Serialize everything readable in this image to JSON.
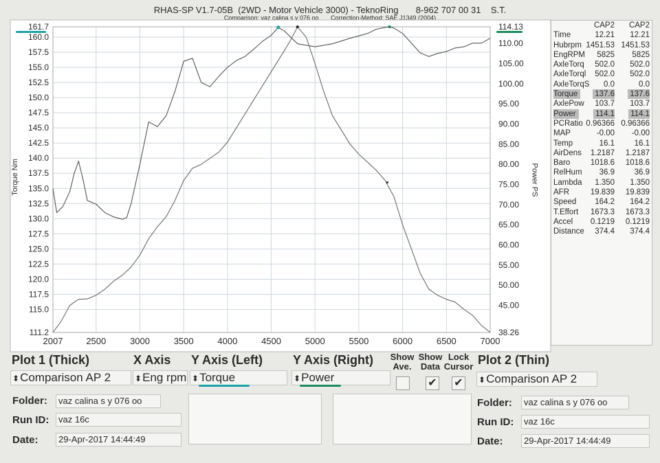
{
  "header": {
    "title": "RHAS-SP V1.7-05B  (2WD - Motor Vehicle 3000) - TeknoRing       8-962 707 00 31    S.T.",
    "subtitle": "Comparison: vaz calina s y 076 oo       Correction-Method: SAE J1349 (2004)"
  },
  "chart_data": {
    "type": "line",
    "xlabel": "",
    "ylabel_left": "Torque Nm",
    "ylabel_right": "Power PS",
    "xlim": [
      2007,
      7000
    ],
    "ylim_left": [
      111.2,
      161.7
    ],
    "ylim_right": [
      38.26,
      114.13
    ],
    "x_ticks": [
      "2007",
      "2500",
      "3000",
      "3500",
      "4000",
      "4500",
      "5000",
      "5500",
      "6000",
      "6500",
      "7000"
    ],
    "left_ticks": [
      "161.7",
      "160.0",
      "157.5",
      "155.0",
      "152.5",
      "150.0",
      "147.5",
      "145.0",
      "142.5",
      "140.0",
      "137.5",
      "135.0",
      "132.5",
      "130.0",
      "127.5",
      "125.0",
      "122.5",
      "120.0",
      "117.5",
      "115.0",
      "111.2"
    ],
    "right_ticks": [
      "114.13",
      "110.00",
      "105.00",
      "100.00",
      "95.00",
      "90.00",
      "85.00",
      "80.00",
      "75.00",
      "70.00",
      "65.00",
      "60.00",
      "55.00",
      "50.00",
      "45.00",
      "38.26"
    ],
    "grid": true,
    "series": [
      {
        "name": "Torque",
        "axis": "left",
        "x": [
          2007,
          2050,
          2120,
          2200,
          2250,
          2300,
          2350,
          2400,
          2500,
          2600,
          2700,
          2800,
          2850,
          2900,
          3000,
          3100,
          3200,
          3300,
          3400,
          3500,
          3600,
          3700,
          3800,
          3900,
          4000,
          4100,
          4200,
          4300,
          4400,
          4500,
          4580,
          4650,
          4800,
          5000,
          5200,
          5400,
          5600,
          5700,
          5800,
          5850,
          5900,
          6000,
          6100,
          6200,
          6300,
          6400,
          6500,
          6600,
          6700,
          6800,
          6900,
          7000
        ],
        "y": [
          135.0,
          131.0,
          132.0,
          134.5,
          137.5,
          139.5,
          136.5,
          133.0,
          132.4,
          131.0,
          130.3,
          129.9,
          130.2,
          132.5,
          139.0,
          146.0,
          145.2,
          147.0,
          151.0,
          156.0,
          156.5,
          152.5,
          151.8,
          153.5,
          155.0,
          156.1,
          156.8,
          158.0,
          159.3,
          160.3,
          161.6,
          161.0,
          158.9,
          158.4,
          158.9,
          159.8,
          160.6,
          161.3,
          161.6,
          161.7,
          161.5,
          160.6,
          159.0,
          157.4,
          156.8,
          157.3,
          157.6,
          158.2,
          158.4,
          159.0,
          159.0,
          159.8
        ]
      },
      {
        "name": "Power",
        "axis": "right",
        "x": [
          2007,
          2100,
          2200,
          2300,
          2400,
          2500,
          2600,
          2700,
          2800,
          2900,
          3000,
          3100,
          3200,
          3300,
          3400,
          3500,
          3600,
          3700,
          3800,
          3900,
          4000,
          4100,
          4200,
          4300,
          4400,
          4500,
          4600,
          4700,
          4800,
          4900,
          5000,
          5100,
          5200,
          5300,
          5400,
          5500,
          5600,
          5700,
          5800,
          5900,
          6000,
          6100,
          6200,
          6300,
          6400,
          6500,
          6600,
          6700,
          6800,
          6900,
          7000
        ],
        "y": [
          38.3,
          41.0,
          45.0,
          46.5,
          46.6,
          47.5,
          49.0,
          51.0,
          52.5,
          54.5,
          57.5,
          61.5,
          64.5,
          67.0,
          71.0,
          76.0,
          79.0,
          80.0,
          81.5,
          83.0,
          85.5,
          89.0,
          92.5,
          96.0,
          99.5,
          103.0,
          106.5,
          110.0,
          114.1,
          111.5,
          105.0,
          98.0,
          92.0,
          88.5,
          85.0,
          82.5,
          80.5,
          78.5,
          76.0,
          72.0,
          65.0,
          59.0,
          53.0,
          49.0,
          47.5,
          46.5,
          45.8,
          44.0,
          42.5,
          40.0,
          38.3
        ]
      }
    ],
    "annotations": [
      {
        "series": "Torque",
        "x": 5850,
        "y": 161.7
      },
      {
        "series": "Power",
        "x": 4800,
        "y": 114.1
      }
    ],
    "colors": {
      "torque": "#555555",
      "power": "#6a6a6a",
      "grid": "#cfd7df",
      "teal_marker": "#1aa2a8",
      "green_marker": "#1a8a5c"
    }
  },
  "readout": {
    "columns": [
      "CAP2",
      "CAP2"
    ],
    "rows": [
      {
        "name": "Time",
        "v1": "12.21",
        "v2": "12.21",
        "hl": false
      },
      {
        "name": "Hubrpm",
        "v1": "1451.53",
        "v2": "1451.53",
        "hl": false
      },
      {
        "name": "EngRPM",
        "v1": "5825",
        "v2": "5825",
        "hl": false
      },
      {
        "name": "AxleTorq",
        "v1": "502.0",
        "v2": "502.0",
        "hl": false
      },
      {
        "name": "AxleTorql",
        "v1": "502.0",
        "v2": "502.0",
        "hl": false
      },
      {
        "name": "AxleTorqS",
        "v1": "0.0",
        "v2": "0.0",
        "hl": false
      },
      {
        "name": "Torque",
        "v1": "137.6",
        "v2": "137.6",
        "hl": true
      },
      {
        "name": "AxlePow",
        "v1": "103.7",
        "v2": "103.7",
        "hl": false
      },
      {
        "name": "Power",
        "v1": "114.1",
        "v2": "114.1",
        "hl": true
      },
      {
        "name": "PCRatio",
        "v1": "0.96366",
        "v2": "0.96366",
        "hl": false
      },
      {
        "name": "MAP",
        "v1": "-0.00",
        "v2": "-0.00",
        "hl": false
      },
      {
        "name": "Temp",
        "v1": "16.1",
        "v2": "16.1",
        "hl": false
      },
      {
        "name": "AirDens",
        "v1": "1.2187",
        "v2": "1.2187",
        "hl": false
      },
      {
        "name": "Baro",
        "v1": "1018.6",
        "v2": "1018.6",
        "hl": false
      },
      {
        "name": "RelHum",
        "v1": "36.9",
        "v2": "36.9",
        "hl": false
      },
      {
        "name": "Lambda",
        "v1": "1.350",
        "v2": "1.350",
        "hl": false
      },
      {
        "name": "AFR",
        "v1": "19.839",
        "v2": "19.839",
        "hl": false
      },
      {
        "name": "Speed",
        "v1": "164.2",
        "v2": "164.2",
        "hl": false
      },
      {
        "name": "T.Effort",
        "v1": "1673.3",
        "v2": "1673.3",
        "hl": false
      },
      {
        "name": "Accel",
        "v1": "0.1219",
        "v2": "0.1219",
        "hl": false
      },
      {
        "name": "Distance",
        "v1": "374.4",
        "v2": "374.4",
        "hl": false
      }
    ]
  },
  "controls": {
    "plot1_header": "Plot 1 (Thick)",
    "xaxis_header": "X Axis",
    "yleft_header": "Y Axis (Left)",
    "yright_header": "Y Axis (Right)",
    "show_ave_label": "Show Ave.",
    "show_data_label": "Show Data",
    "lock_cursor_label": "Lock Cursor",
    "plot2_header": "Plot 2 (Thin)",
    "plot1_select": "Comparison AP 2",
    "xaxis_select": "Eng rpm",
    "yleft_select": "Torque",
    "yright_select": "Power",
    "plot2_select": "Comparison AP 2",
    "show_ave_checked": false,
    "show_data_checked": true,
    "lock_cursor_checked": true,
    "check_glyph": "✔",
    "arrow_glyph": "⬍"
  },
  "plot1_info": {
    "folder_label": "Folder:",
    "folder": "vaz calina s y 076 oo",
    "runid_label": "Run ID:",
    "runid": "vaz 16c",
    "date_label": "Date:",
    "date": "29-Apr-2017  14:44:49"
  },
  "plot2_info": {
    "folder_label": "Folder:",
    "folder": "vaz calina s y 076 oo",
    "runid_label": "Run ID:",
    "runid": "vaz 16c",
    "date_label": "Date:",
    "date": "29-Apr-2017  14:44:49"
  }
}
